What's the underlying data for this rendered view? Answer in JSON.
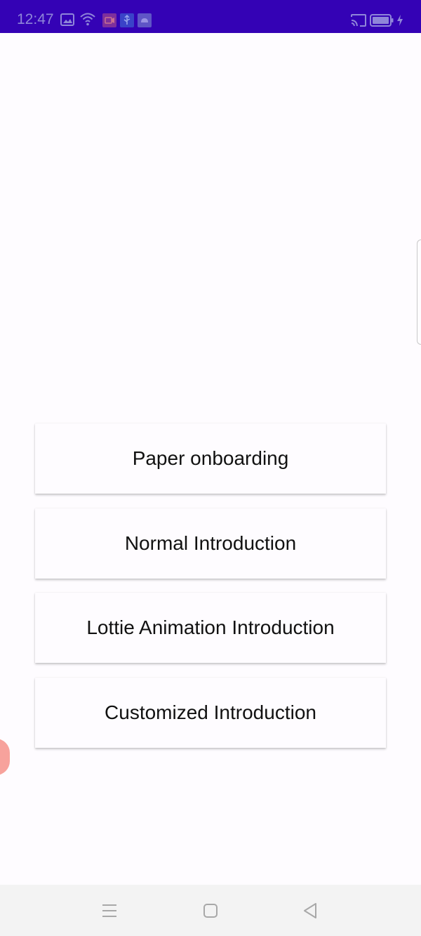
{
  "status_bar": {
    "time": "12:47",
    "background_color": "#3402b5",
    "icons": [
      "image-icon",
      "wifi-icon",
      "screen-record-icon",
      "usb-icon",
      "android-icon",
      "cast-icon",
      "battery-icon",
      "charging-icon"
    ]
  },
  "buttons": {
    "paper_onboarding": "Paper onboarding",
    "normal_introduction": "Normal Introduction",
    "lottie_animation_introduction": "Lottie Animation Introduction",
    "customized_introduction": "Customized Introduction"
  },
  "navigation_bar": {
    "icons": [
      "menu-icon",
      "home-square-icon",
      "back-triangle-icon"
    ]
  },
  "colors": {
    "page_background": "#fefcff",
    "button_text": "#111111",
    "floating_bubble": "#f7a29c",
    "nav_bar_background": "#f3f3f3"
  }
}
